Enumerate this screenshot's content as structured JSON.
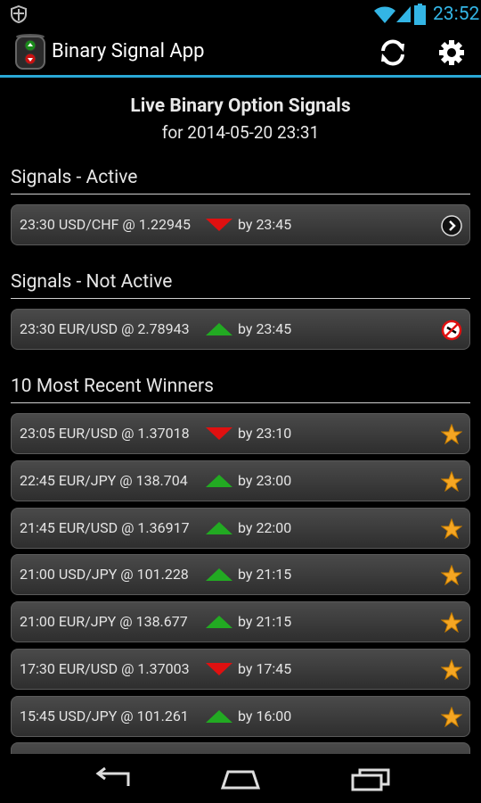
{
  "status_bar": {
    "time": "23:52",
    "accent": "#33b5e5"
  },
  "app": {
    "title": "Binary Signal App"
  },
  "toolbar": {
    "refresh_icon": "refresh-icon",
    "settings_icon": "gear-icon"
  },
  "header": {
    "title": "Live Binary Option Signals",
    "subtitle": "for 2014-05-20 23:31"
  },
  "sections": {
    "active": {
      "label": "Signals - Active",
      "rows": [
        {
          "text": "23:30 USD/CHF @ 1.22945",
          "direction": "down",
          "by": "by 23:45",
          "icon": "chevron-right-icon"
        }
      ]
    },
    "not_active": {
      "label": "Signals - Not Active",
      "rows": [
        {
          "text": "23:30 EUR/USD @ 2.78943",
          "direction": "up",
          "by": "by 23:45",
          "icon": "no-entry-icon"
        }
      ]
    },
    "winners": {
      "label": "10 Most Recent Winners",
      "rows": [
        {
          "text": "23:05 EUR/USD @ 1.37018",
          "direction": "down",
          "by": "by 23:10",
          "icon": "star-icon"
        },
        {
          "text": "22:45 EUR/JPY @ 138.704",
          "direction": "up",
          "by": "by 23:00",
          "icon": "star-icon"
        },
        {
          "text": "21:45 EUR/USD @ 1.36917",
          "direction": "up",
          "by": "by 22:00",
          "icon": "star-icon"
        },
        {
          "text": "21:00 USD/JPY @ 101.228",
          "direction": "up",
          "by": "by 21:15",
          "icon": "star-icon"
        },
        {
          "text": "21:00 EUR/JPY @ 138.677",
          "direction": "up",
          "by": "by 21:15",
          "icon": "star-icon"
        },
        {
          "text": "17:30 EUR/USD @ 1.37003",
          "direction": "down",
          "by": "by 17:45",
          "icon": "star-icon"
        },
        {
          "text": "15:45 USD/JPY @ 101.261",
          "direction": "up",
          "by": "by 16:00",
          "icon": "star-icon"
        }
      ]
    }
  },
  "colors": {
    "up": "#22aa22",
    "down": "#e01010",
    "star": "#f5a623",
    "accent_line": "#2aa8d6"
  }
}
